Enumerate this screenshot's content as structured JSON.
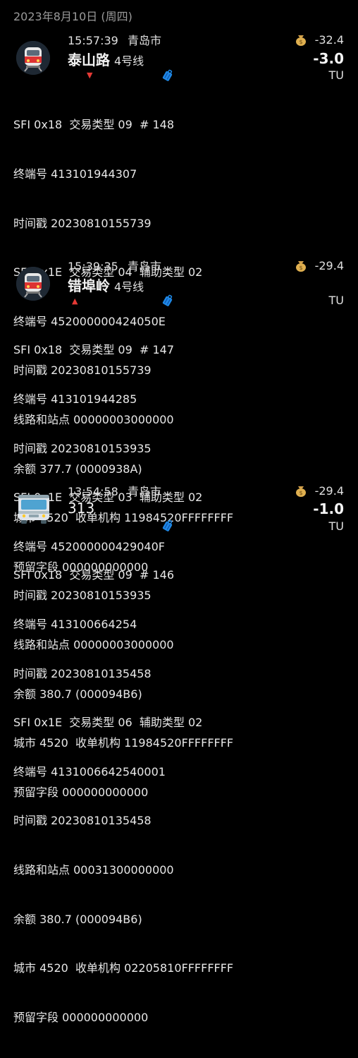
{
  "date_header": "2023年8月10日 (周四)",
  "entries": [
    {
      "time": "15:57:39",
      "city": "青岛市",
      "station": "泰山路",
      "line": "4号线",
      "balance": "-32.4",
      "amount": "-3.0",
      "unit": "TU",
      "icon": "subway-icon",
      "direction": "down",
      "details": [
        "SFI 0x18  交易类型 09  # 148",
        "终端号 413101944307",
        "时间戳 20230810155739",
        "SFI 0x1E  交易类型 04  辅助类型 02",
        "终端号 452000000424050E",
        "时间戳 20230810155739",
        "线路和站点 00000003000000",
        "余额 377.7 (0000938A)",
        "城市 4520  收单机构 11984520FFFFFFFF",
        "预留字段 000000000000"
      ]
    },
    {
      "time": "15:39:35",
      "city": "青岛市",
      "station": "错埠岭",
      "line": "4号线",
      "balance": "-29.4",
      "amount": "",
      "unit": "TU",
      "icon": "subway-icon",
      "direction": "up",
      "details": [
        "SFI 0x18  交易类型 09  # 147",
        "终端号 413101944285",
        "时间戳 20230810153935",
        "SFI 0x1E  交易类型 03  辅助类型 02",
        "终端号 452000000429040F",
        "时间戳 20230810153935",
        "线路和站点 00000003000000",
        "余额 380.7 (000094B6)",
        "城市 4520  收单机构 11984520FFFFFFFF",
        "预留字段 000000000000"
      ]
    },
    {
      "time": "13:54:58",
      "city": "青岛市",
      "station": "313",
      "line": "",
      "balance": "-29.4",
      "amount": "-1.0",
      "unit": "TU",
      "icon": "bus-icon",
      "direction": "",
      "details": [
        "SFI 0x18  交易类型 09  # 146",
        "终端号 413100664254",
        "时间戳 20230810135458",
        "SFI 0x1E  交易类型 06  辅助类型 02",
        "终端号 4131006642540001",
        "时间戳 20230810135458",
        "线路和站点 00031300000000",
        "余额 380.7 (000094B6)",
        "城市 4520  收单机构 02205810FFFFFFFF",
        "预留字段 000000000000"
      ]
    }
  ],
  "colors": {
    "background": "#000000",
    "text": "#e6e6e6",
    "date": "#9a9a9a",
    "arrow": "#e53935",
    "luggage": "#1e88e5"
  }
}
